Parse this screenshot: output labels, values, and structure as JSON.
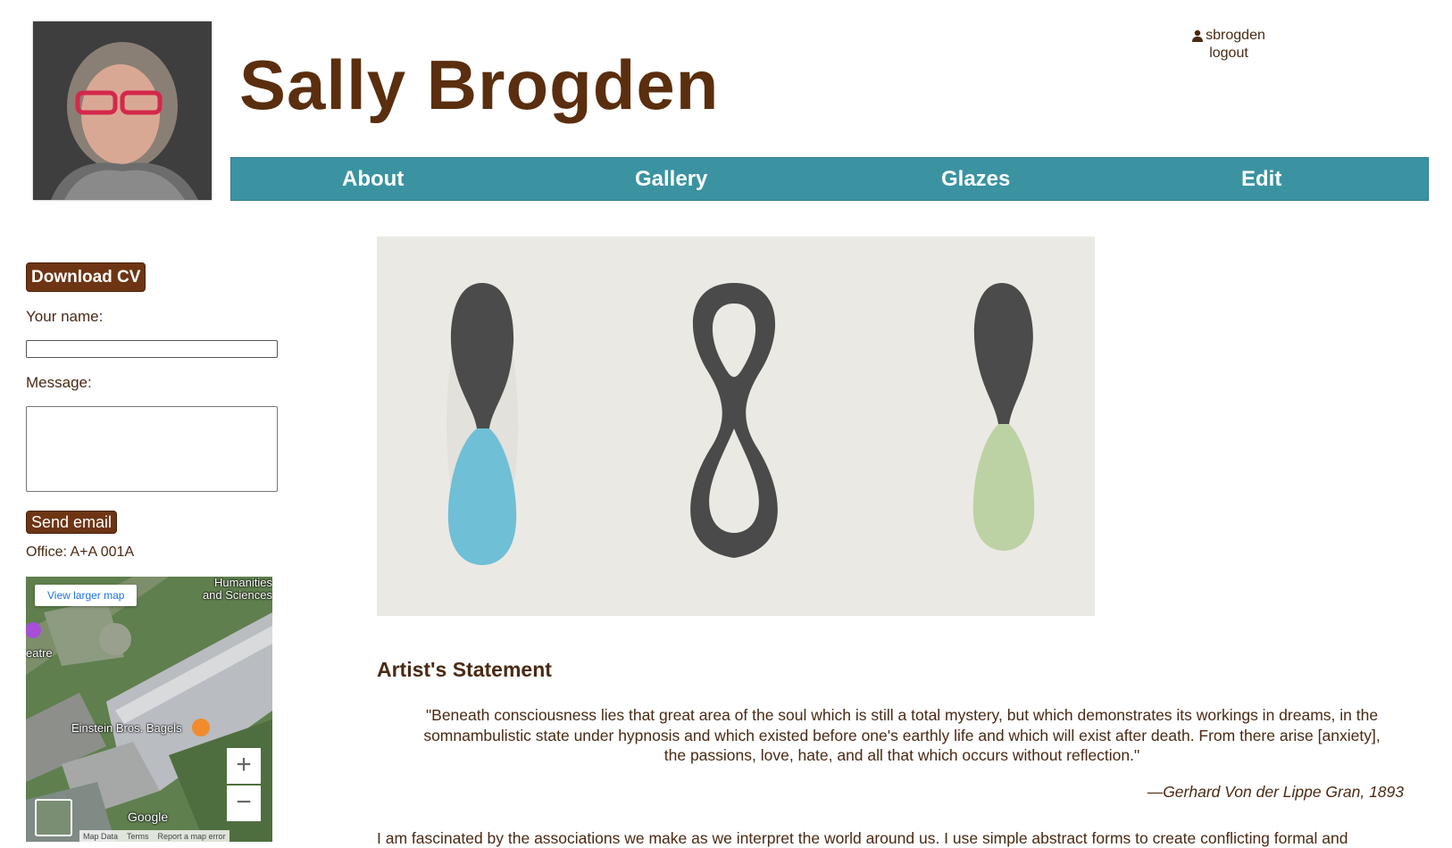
{
  "header": {
    "site_title": "Sally Brogden",
    "username": "sbrogden",
    "logout_label": "logout",
    "user_icon": "user-icon"
  },
  "nav": {
    "items": [
      {
        "label": "About"
      },
      {
        "label": "Gallery"
      },
      {
        "label": "Glazes"
      },
      {
        "label": "Edit"
      }
    ]
  },
  "sidebar": {
    "download_cv_label": "Download CV",
    "name_label": "Your name:",
    "name_value": "",
    "message_label": "Message:",
    "message_value": "",
    "send_label": "Send email",
    "office_text": "Office: A+A 001A",
    "map": {
      "view_larger_label": "View larger map",
      "labels": {
        "humanities": "Humanities and Sciences",
        "theatre": "eatre",
        "einstein": "Einstein Bros. Bagels",
        "google": "Google"
      },
      "zoom_in": "+",
      "zoom_out": "−",
      "footer": {
        "map_data": "Map Data",
        "terms": "Terms",
        "report": "Report a map error"
      }
    }
  },
  "main": {
    "statement_heading": "Artist's Statement",
    "quote": "\"Beneath consciousness lies that great area of the soul which is still a total mystery, but which demonstrates its workings in dreams, in the somnambulistic state under hypnosis and which existed before one's earthly life and which will exist after death. From there arise [anxiety], the passions, love, hate, and all that which occurs without reflection.\"",
    "attribution": "—Gerhard Von der Lippe Gran, 1893",
    "body_text": "I am fascinated by the associations we make as we interpret the world around us. I use simple abstract forms to create conflicting formal and"
  },
  "colors": {
    "brand_brown": "#6e3514",
    "nav_teal": "#3b93a1",
    "text_brown": "#4a2a14"
  }
}
